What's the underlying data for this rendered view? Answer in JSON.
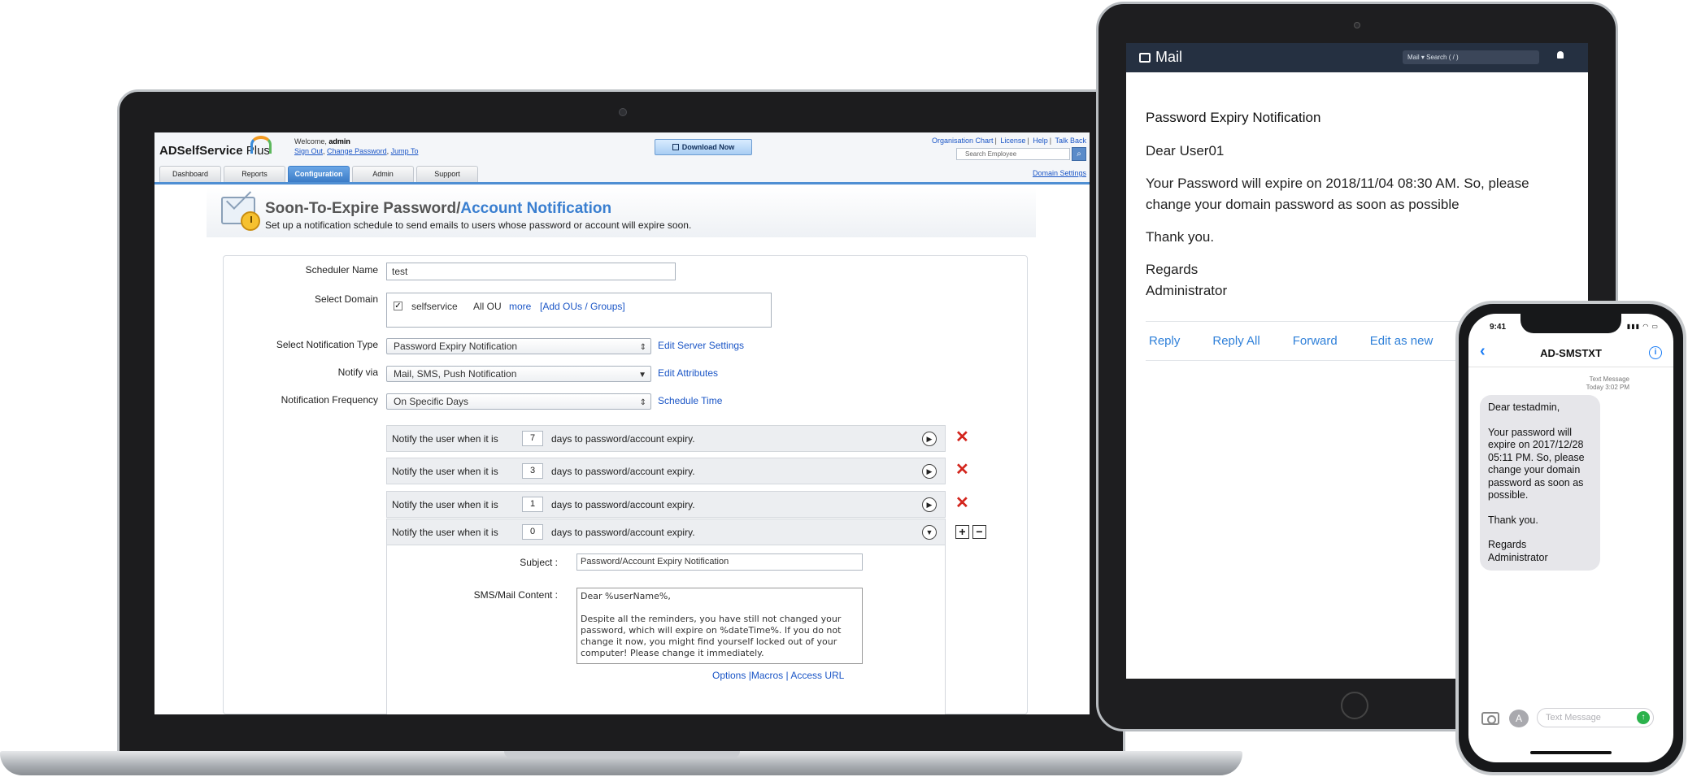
{
  "laptop": {
    "app": {
      "logo": "ADSelfService",
      "logo_plus": "Plus",
      "welcome_prefix": "Welcome,",
      "user": "admin",
      "sign_out": "Sign Out",
      "change_password": "Change Password",
      "jump_to": "Jump To",
      "download": "Download Now",
      "top_links": [
        "Organisation Chart",
        "License",
        "Help",
        "Talk Back"
      ],
      "search_placeholder": "Search Employee",
      "domain_settings": "Domain Settings",
      "tabs": [
        "Dashboard",
        "Reports",
        "Configuration",
        "Admin",
        "Support"
      ],
      "active_tab": "Configuration"
    },
    "page": {
      "title_part1": "Soon-To-Expire Password/",
      "title_part2": "Account Notification",
      "subtitle": "Set up a notification schedule to send emails to users whose password or account will expire soon."
    },
    "form": {
      "scheduler_label": "Scheduler Name",
      "scheduler_value": "test",
      "domain_label": "Select Domain",
      "domain_name": "selfservice",
      "domain_ou": "All OU",
      "domain_more": "more",
      "domain_add": "[Add OUs / Groups]",
      "notif_type_label": "Select Notification Type",
      "notif_type_value": "Password Expiry Notification",
      "notif_type_link": "Edit Server Settings",
      "notify_via_label": "Notify via",
      "notify_via_value": "Mail, SMS, Push Notification",
      "notify_via_link": "Edit Attributes",
      "freq_label": "Notification Frequency",
      "freq_value": "On Specific Days",
      "freq_link": "Schedule Time",
      "rows": [
        {
          "prefix": "Notify the user when it is",
          "days": "7",
          "suffix": "days to password/account expiry."
        },
        {
          "prefix": "Notify the user when it is",
          "days": "3",
          "suffix": "days to password/account expiry."
        },
        {
          "prefix": "Notify the user when it is",
          "days": "1",
          "suffix": "days to password/account expiry."
        },
        {
          "prefix": "Notify the user when it is",
          "days": "0",
          "suffix": "days to password/account expiry."
        }
      ],
      "subject_label": "Subject :",
      "subject_value": "Password/Account Expiry Notification",
      "content_label": "SMS/Mail Content :",
      "content_line1": "Dear %userName%,",
      "content_line2": "Despite all the reminders, you have still not changed your password, which will expire on %dateTime%. If you do not change it now, you might find yourself locked out of your computer! Please change it immediately.",
      "links": [
        "Options",
        "|Macros",
        "|",
        "Access URL"
      ]
    }
  },
  "tablet": {
    "app_name": "Mail",
    "search": "Mail ▾   Search ( / )",
    "subject": "Password Expiry Notification",
    "greeting": "Dear User01",
    "body": "Your Password will expire on 2018/11/04 08:30 AM. So, please change your domain password as soon as possible",
    "thanks": "Thank you.",
    "regards": "Regards",
    "signature": "Administrator",
    "actions": [
      "Reply",
      "Reply All",
      "Forward",
      "Edit as new"
    ]
  },
  "phone": {
    "time": "9:41",
    "contact": "AD-SMSTXT",
    "meta_line1": "Text Message",
    "meta_line2": "Today 3:02 PM",
    "msg_greeting": "Dear testadmin,",
    "msg_body": "Your password will expire on 2017/12/28 05:11 PM. So, please change your domain password as soon as possible.",
    "msg_thanks": "Thank you.",
    "msg_regards": "Regards",
    "msg_sign": "Administrator",
    "input_placeholder": "Text Message"
  },
  "colors": {
    "accent_blue": "#3a7fd0",
    "link_blue": "#1a55c6",
    "delete_red": "#d3251d",
    "ios_blue": "#1a7cf5",
    "mail_bar": "#253041"
  }
}
